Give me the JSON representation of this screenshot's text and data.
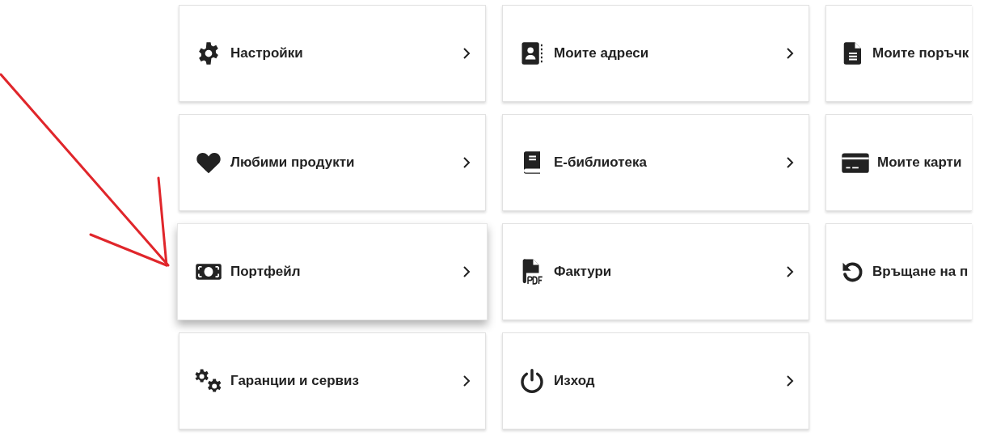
{
  "cards": [
    {
      "label": "Настройки",
      "highlighted": false
    },
    {
      "label": "Моите адреси",
      "highlighted": false
    },
    {
      "label": "Моите поръчк",
      "highlighted": false
    },
    {
      "label": "Любими продукти",
      "highlighted": false
    },
    {
      "label": "Е-библиотека",
      "highlighted": false
    },
    {
      "label": "Моите карти",
      "highlighted": false
    },
    {
      "label": "Портфейл",
      "highlighted": true
    },
    {
      "label": "Фактури",
      "highlighted": false
    },
    {
      "label": "Връщане на п",
      "highlighted": false
    },
    {
      "label": "Гаранции и сервиз",
      "highlighted": false
    },
    {
      "label": "Изход",
      "highlighted": false
    }
  ]
}
